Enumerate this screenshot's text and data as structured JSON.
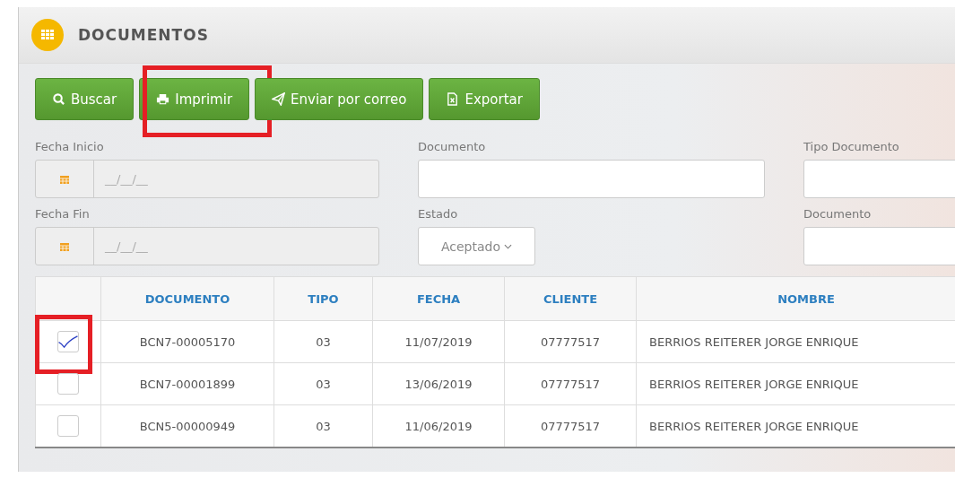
{
  "header": {
    "title": "DOCUMENTOS"
  },
  "toolbar": [
    {
      "label": "Buscar",
      "kind": "search",
      "highlighted": false
    },
    {
      "label": "Imprimir",
      "kind": "print",
      "highlighted": true
    },
    {
      "label": "Enviar por correo",
      "kind": "send",
      "highlighted": false
    },
    {
      "label": "Exportar",
      "kind": "export",
      "highlighted": false
    }
  ],
  "filters": [
    {
      "label": "Fecha Inicio",
      "kind": "date",
      "placeholder": "__/__/__"
    },
    {
      "label": "Documento",
      "kind": "text"
    },
    {
      "label": "Tipo Documento",
      "kind": "text"
    },
    {
      "label": "Fecha Fin",
      "kind": "date",
      "placeholder": "__/__/__"
    },
    {
      "label": "Estado",
      "kind": "select",
      "value": "Aceptado"
    },
    {
      "label": "Documento",
      "kind": "text"
    }
  ],
  "table": {
    "columns": [
      "DOCUMENTO",
      "TIPO",
      "FECHA",
      "CLIENTE",
      "NOMBRE"
    ],
    "rows": [
      {
        "checked": true,
        "highlighted": true,
        "cells": [
          "BCN7-00005170",
          "03",
          "11/07/2019",
          "07777517",
          "BERRIOS REITERER JORGE ENRIQUE"
        ]
      },
      {
        "checked": false,
        "highlighted": false,
        "cells": [
          "BCN7-00001899",
          "03",
          "13/06/2019",
          "07777517",
          "BERRIOS REITERER JORGE ENRIQUE"
        ]
      },
      {
        "checked": false,
        "highlighted": false,
        "cells": [
          "BCN5-00000949",
          "03",
          "11/06/2019",
          "07777517",
          "BERRIOS REITERER JORGE ENRIQUE"
        ]
      }
    ]
  }
}
